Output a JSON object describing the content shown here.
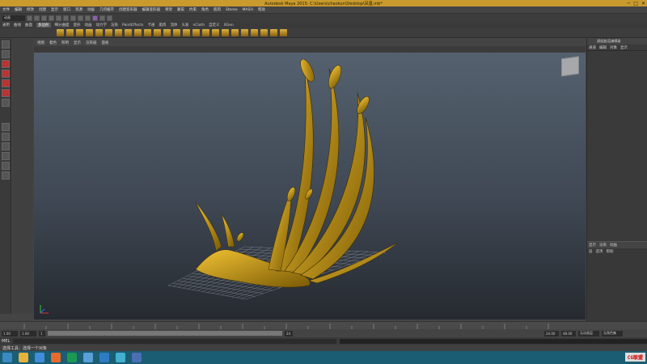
{
  "window": {
    "title": "Autodesk Maya 2015: C:\\Users\\chaokun\\Desktop\\凤凰.mb*"
  },
  "menubar": {
    "items": [
      "文件",
      "编辑",
      "修改",
      "创建",
      "显示",
      "窗口",
      "资源",
      "动画",
      "几何缓存",
      "创建变形器",
      "编辑变形器",
      "骨架",
      "蒙皮",
      "约束",
      "角色",
      "肌肉",
      "Stereo",
      "MASH",
      "帮助"
    ]
  },
  "status": {
    "mode": "动画"
  },
  "shelf_tabs": {
    "items": [
      "通用",
      "曲线",
      "曲面",
      "多边形",
      "细分曲面",
      "变形",
      "动画",
      "动力学",
      "渲染",
      "PaintEffects",
      "卡通",
      "肌肉",
      "流体",
      "头发",
      "nCloth",
      "自定义",
      "XGen"
    ],
    "active": 3
  },
  "panel_menu": {
    "items": [
      "视图",
      "着色",
      "照明",
      "显示",
      "渲染器",
      "面板"
    ]
  },
  "channel_box": {
    "title": "通道盒/层编辑器",
    "tabs": [
      "通道",
      "编辑",
      "对象",
      "显示"
    ]
  },
  "layer_editor": {
    "tabs": [
      "显示",
      "渲染",
      "动画"
    ],
    "menu": [
      "层",
      "选项",
      "帮助"
    ]
  },
  "time": {
    "start": "1.00",
    "current": "1.00",
    "range_start": "1",
    "range_end": "24",
    "end": "24.00",
    "anim_end": "48.00",
    "playback": "1.00",
    "no_anim_layer": "无动画层",
    "no_char": "无角色集"
  },
  "cmd": {
    "label": "MEL"
  },
  "helpline": {
    "text": "选择工具：选择一个对象"
  },
  "taskbar": {
    "watermark": "CG联盟"
  }
}
